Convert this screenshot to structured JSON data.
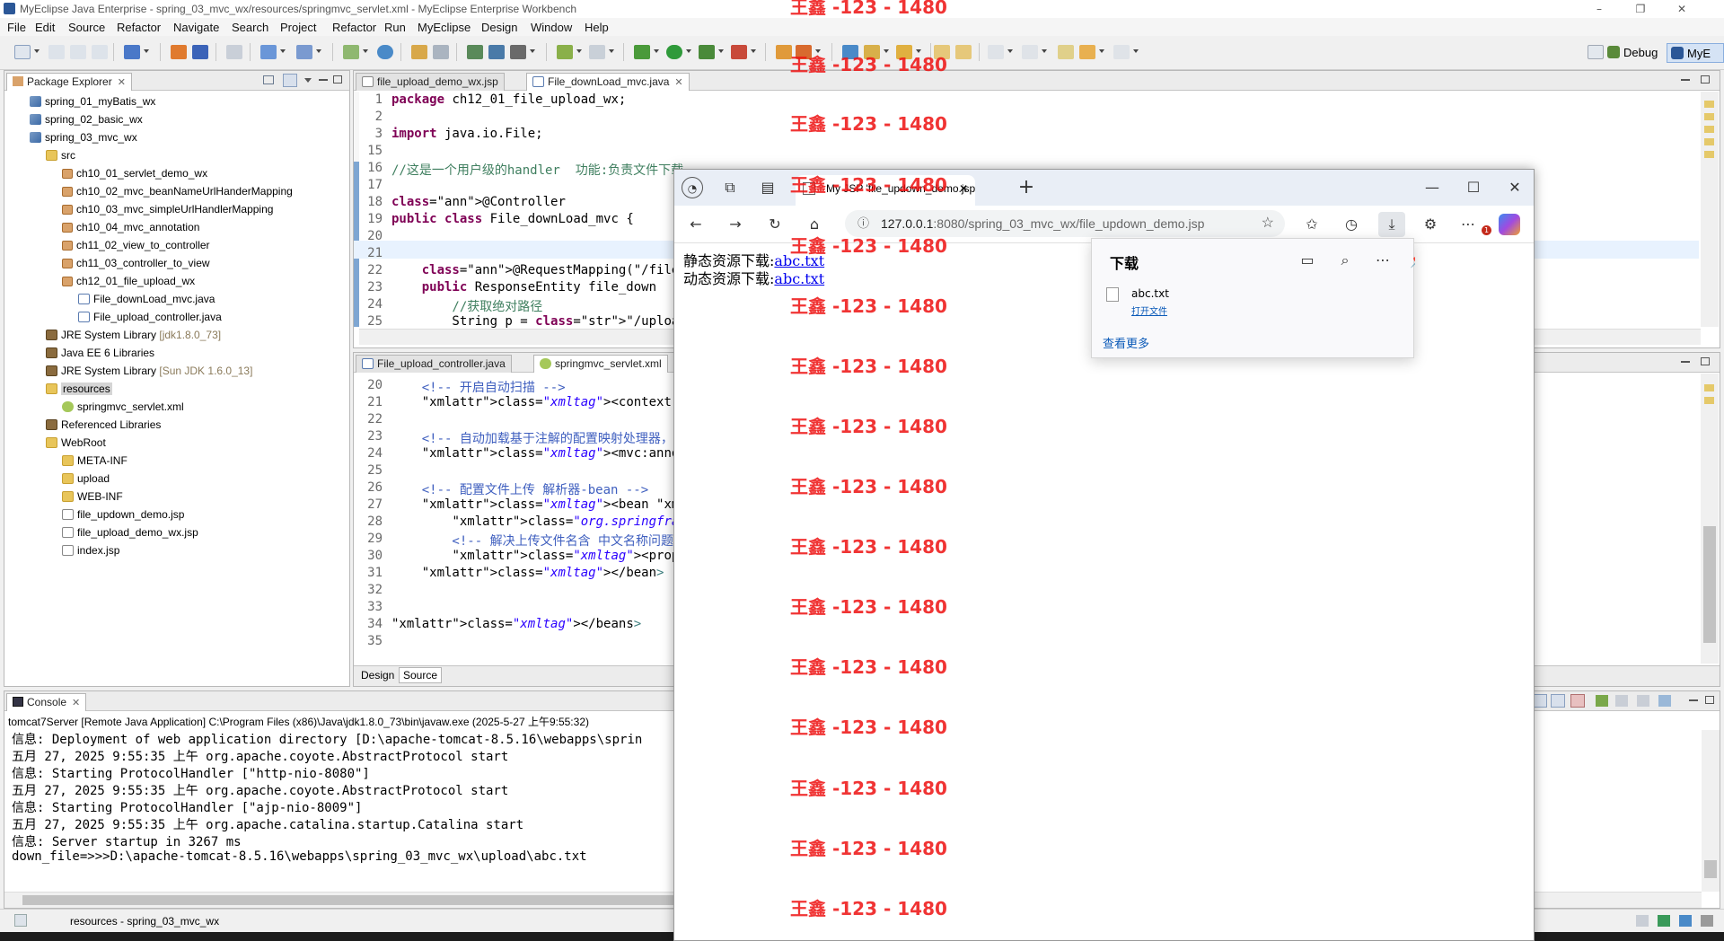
{
  "window": {
    "title": "MyEclipse Java Enterprise - spring_03_mvc_wx/resources/springmvc_servlet.xml - MyEclipse Enterprise Workbench",
    "minimize": "–",
    "restore": "❐",
    "close": "✕"
  },
  "menu": [
    "File",
    "Edit",
    "Source",
    "Refactor",
    "Navigate",
    "Search",
    "Project",
    "Refactor",
    "Run",
    "MyEclipse",
    "Design",
    "Window",
    "Help"
  ],
  "perspectives": {
    "debug": "Debug",
    "myeclipse": "MyE"
  },
  "package_explorer": {
    "title": "Package Explorer",
    "items": [
      {
        "label": "spring_01_myBatis_wx",
        "icon": "project-icon",
        "depth": 0
      },
      {
        "label": "spring_02_basic_wx",
        "icon": "project-icon",
        "depth": 0
      },
      {
        "label": "spring_03_mvc_wx",
        "icon": "project-icon",
        "depth": 0
      },
      {
        "label": "src",
        "icon": "source-folder-icon",
        "depth": 1
      },
      {
        "label": "ch10_01_servlet_demo_wx",
        "icon": "package-icon",
        "depth": 2
      },
      {
        "label": "ch10_02_mvc_beanNameUrlHanderMapping",
        "icon": "package-icon",
        "depth": 2
      },
      {
        "label": "ch10_03_mvc_simpleUrlHandlerMapping",
        "icon": "package-icon",
        "depth": 2
      },
      {
        "label": "ch10_04_mvc_annotation",
        "icon": "package-icon",
        "depth": 2
      },
      {
        "label": "ch11_02_view_to_controller",
        "icon": "package-icon",
        "depth": 2
      },
      {
        "label": "ch11_03_controller_to_view",
        "icon": "package-icon",
        "depth": 2
      },
      {
        "label": "ch12_01_file_upload_wx",
        "icon": "package-icon",
        "depth": 2
      },
      {
        "label": "File_downLoad_mvc.java",
        "icon": "java-file-icon",
        "depth": 3
      },
      {
        "label": "File_upload_controller.java",
        "icon": "java-file-icon",
        "depth": 3
      },
      {
        "label": "JRE System Library",
        "suffix": "[jdk1.8.0_73]",
        "icon": "library-icon",
        "depth": 1
      },
      {
        "label": "Java EE 6 Libraries",
        "icon": "library-icon",
        "depth": 1
      },
      {
        "label": "JRE System Library",
        "suffix": "[Sun JDK 1.6.0_13]",
        "icon": "library-icon",
        "depth": 1
      },
      {
        "label": "resources",
        "icon": "source-folder-icon",
        "depth": 1,
        "selected": true
      },
      {
        "label": "springmvc_servlet.xml",
        "icon": "xml-file-icon",
        "depth": 2
      },
      {
        "label": "Referenced Libraries",
        "icon": "library-icon",
        "depth": 1
      },
      {
        "label": "WebRoot",
        "icon": "folder-icon",
        "depth": 1
      },
      {
        "label": "META-INF",
        "icon": "folder-icon",
        "depth": 2
      },
      {
        "label": "upload",
        "icon": "folder-icon",
        "depth": 2
      },
      {
        "label": "WEB-INF",
        "icon": "folder-icon",
        "depth": 2
      },
      {
        "label": "file_updown_demo.jsp",
        "icon": "jsp-file-icon",
        "depth": 2
      },
      {
        "label": "file_upload_demo_wx.jsp",
        "icon": "jsp-file-icon",
        "depth": 2
      },
      {
        "label": "index.jsp",
        "icon": "jsp-file-icon",
        "depth": 2
      }
    ]
  },
  "editor_top": {
    "tabs": [
      {
        "label": "file_upload_demo_wx.jsp",
        "active": false
      },
      {
        "label": "File_downLoad_mvc.java",
        "active": true
      }
    ],
    "line_numbers": [
      "1",
      "2",
      "3",
      "15",
      "16",
      "17",
      "18",
      "19",
      "20",
      "21",
      "22",
      "23",
      "24",
      "25"
    ],
    "lines": [
      "package ch12_01_file_upload_wx;",
      "",
      "import java.io.File;",
      "",
      "//这是一个用户级的handler  功能:负责文件下载",
      "",
      "@Controller",
      "public class File_downLoad_mvc {",
      "",
      "",
      "    @RequestMapping(\"/file_updown.a",
      "    public ResponseEntity file_down",
      "        //获取绝对路径",
      "        String p = \"/upload/\";"
    ]
  },
  "editor_bottom": {
    "tabs": [
      {
        "label": "File_upload_controller.java",
        "active": false
      },
      {
        "label": "springmvc_servlet.xml",
        "active": true
      }
    ],
    "line_numbers": [
      "20",
      "21",
      "22",
      "23",
      "24",
      "25",
      "26",
      "27",
      "28",
      "29",
      "30",
      "31",
      "32",
      "33",
      "34",
      "35"
    ],
    "lines": [
      "    <!-- 开启自动扫描 -->",
      "    <context:component-scan base-pa",
      "",
      "    <!-- 自动加载基于注解的配置映射处理器，适配",
      "    <mvc:annotation-driven />",
      "",
      "    <!-- 配置文件上传 解析器-bean -->",
      "    <bean id=\"multipartResolver\"",
      "        class=\"org.springframework.",
      "        <!-- 解决上传文件名含 中文名称问题 --",
      "        <property name=\"defaultEnco",
      "    </bean>",
      "",
      "",
      "</beans>",
      ""
    ],
    "bottom_tabs": [
      "Design",
      "Source"
    ]
  },
  "console": {
    "title": "Console",
    "header": "tomcat7Server [Remote Java Application] C:\\Program Files (x86)\\Java\\jdk1.8.0_73\\bin\\javaw.exe (2025-5-27 上午9:55:32)",
    "lines": [
      "信息: Deployment of web application directory [D:\\apache-tomcat-8.5.16\\webapps\\sprin",
      "五月 27, 2025 9:55:35 上午 org.apache.coyote.AbstractProtocol start",
      "信息: Starting ProtocolHandler [\"http-nio-8080\"]",
      "五月 27, 2025 9:55:35 上午 org.apache.coyote.AbstractProtocol start",
      "信息: Starting ProtocolHandler [\"ajp-nio-8009\"]",
      "五月 27, 2025 9:55:35 上午 org.apache.catalina.startup.Catalina start",
      "信息: Server startup in 3267 ms",
      "down_file=>>>D:\\apache-tomcat-8.5.16\\webapps\\spring_03_mvc_wx\\upload\\abc.txt"
    ]
  },
  "status": {
    "selection": "resources - spring_03_mvc_wx"
  },
  "browser": {
    "tab_title": "My JSP 'file_updown_demo.jsp' st",
    "new_tab": "+",
    "url": "127.0.0.1:8080/spring_03_mvc_wx/file_updown_demo.jsp",
    "url_host": "127.0.0.1",
    "url_rest": ":8080/spring_03_mvc_wx/file_updown_demo.jsp",
    "minimize": "—",
    "maximize": "☐",
    "close": "✕",
    "page": {
      "static_label": "静态资源下载:",
      "static_link": "abc.txt",
      "dynamic_label": "动态资源下载:",
      "dynamic_link": "abc.txt"
    },
    "downloads": {
      "title": "下载",
      "file_name": "abc.txt",
      "open_file": "打开文件",
      "see_more": "查看更多"
    },
    "badge": "1"
  },
  "watermark": {
    "text": "王鑫 -123 - 1480",
    "color": "#ee1111"
  }
}
